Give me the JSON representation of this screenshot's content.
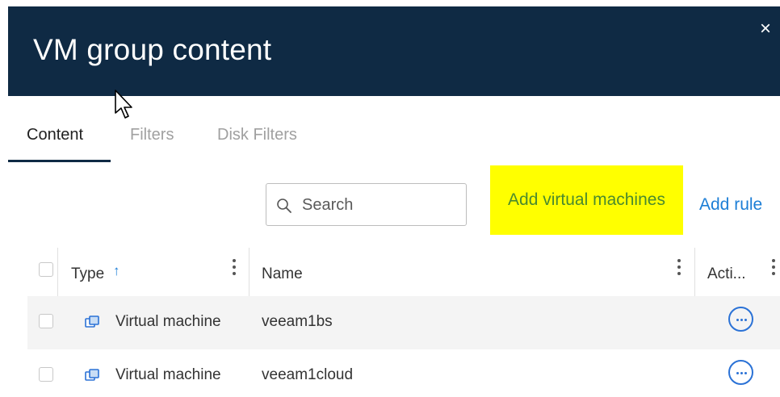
{
  "dialog": {
    "title": "VM group content",
    "close_label": "×"
  },
  "tabs": [
    {
      "label": "Content",
      "active": true
    },
    {
      "label": "Filters",
      "active": false
    },
    {
      "label": "Disk Filters",
      "active": false
    }
  ],
  "toolbar": {
    "search_placeholder": "Search",
    "add_vm_label": "Add virtual machines",
    "add_rule_label": "Add rule"
  },
  "table": {
    "columns": [
      "Type",
      "Name",
      "Acti..."
    ],
    "sort": {
      "column": "Type",
      "direction": "ascending"
    },
    "rows": [
      {
        "type": "Virtual machine",
        "name": "veeam1bs"
      },
      {
        "type": "Virtual machine",
        "name": "veeam1cloud"
      }
    ]
  },
  "colors": {
    "header_bg": "#0f2a44",
    "accent": "#1c7ed6",
    "highlight": "#ffff00",
    "highlight_text": "#4a8a2e"
  },
  "icons": [
    "close-icon",
    "search-icon",
    "sort-ascending-icon",
    "kebab-icon",
    "virtual-machine-icon",
    "more-actions-icon",
    "mouse-pointer"
  ]
}
